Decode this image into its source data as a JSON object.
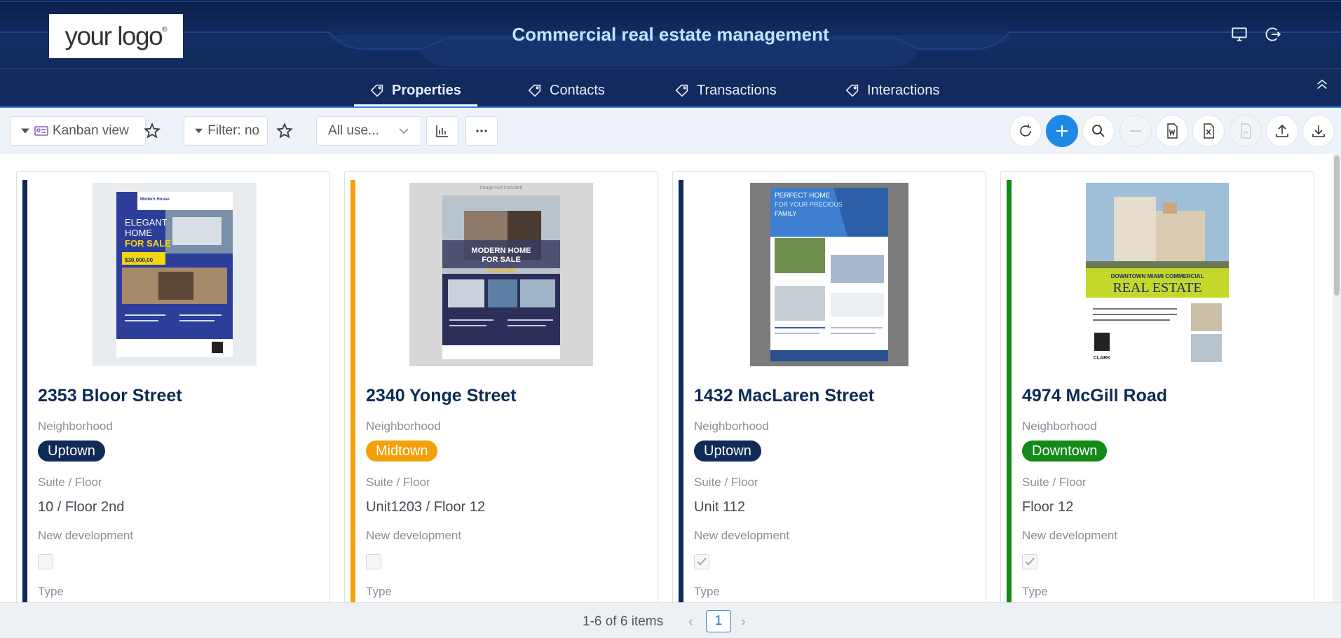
{
  "app": {
    "title": "Commercial real estate management",
    "logo_text": "your logo",
    "logo_mark": "®"
  },
  "header_icons": [
    "monitor-icon",
    "logout-icon"
  ],
  "tabs": [
    {
      "label": "Properties",
      "active": true
    },
    {
      "label": "Contacts",
      "active": false
    },
    {
      "label": "Transactions",
      "active": false
    },
    {
      "label": "Interactions",
      "active": false
    }
  ],
  "toolbar": {
    "view_label": "Kanban view",
    "filter_label": "Filter: no",
    "users_select": "All use...",
    "buttons": [
      "refresh-icon",
      "add-icon",
      "search-icon",
      "minus-icon",
      "word-export-icon",
      "excel-export-icon",
      "pdf-export-icon",
      "upload-icon",
      "download-icon"
    ]
  },
  "cards": [
    {
      "title": "2353 Bloor Street",
      "neighborhood_label": "Neighborhood",
      "neighborhood": "Uptown",
      "suite_label": "Suite / Floor",
      "suite": "10 / Floor 2nd",
      "newdev_label": "New development",
      "new_development": false,
      "type_label": "Type",
      "stripe_color": "#0d2b55",
      "pill_color": "#0d2b55",
      "flyer": {
        "brand": "Modern House",
        "headline1": "ELEGANT",
        "headline2": "HOME",
        "headline3": "FOR SALE",
        "price": "$30,000,00"
      }
    },
    {
      "title": "2340 Yonge Street",
      "neighborhood_label": "Neighborhood",
      "neighborhood": "Midtown",
      "suite_label": "Suite / Floor",
      "suite": "Unit1203 / Floor 12",
      "newdev_label": "New development",
      "new_development": false,
      "type_label": "Type",
      "stripe_color": "#f5a00a",
      "pill_color": "#f5a00a",
      "flyer": {
        "note": "Image Not Included",
        "headline1": "MODERN HOME",
        "headline2": "FOR SALE",
        "price": "$2,500,000"
      }
    },
    {
      "title": "1432 MacLaren Street",
      "neighborhood_label": "Neighborhood",
      "neighborhood": "Uptown",
      "suite_label": "Suite / Floor",
      "suite": "Unit 112",
      "newdev_label": "New development",
      "new_development": true,
      "type_label": "Type",
      "stripe_color": "#0d2b55",
      "pill_color": "#0d2b55",
      "flyer": {
        "headline1": "PERFECT HOME",
        "headline2": "FOR YOUR PRECIOUS",
        "headline3": "FAMILY"
      }
    },
    {
      "title": "4974 McGill Road",
      "neighborhood_label": "Neighborhood",
      "neighborhood": "Downtown",
      "suite_label": "Suite / Floor",
      "suite": "Floor 12",
      "newdev_label": "New development",
      "new_development": true,
      "type_label": "Type",
      "stripe_color": "#138a18",
      "pill_color": "#138a18",
      "flyer": {
        "headline1": "DOWNTOWN MIAMI COMMERCIAL",
        "headline2": "REAL ESTATE",
        "brand": "CLARK"
      }
    }
  ],
  "pager": {
    "summary": "1-6 of 6 items",
    "current_page": "1",
    "prev": "‹",
    "next": "›"
  }
}
